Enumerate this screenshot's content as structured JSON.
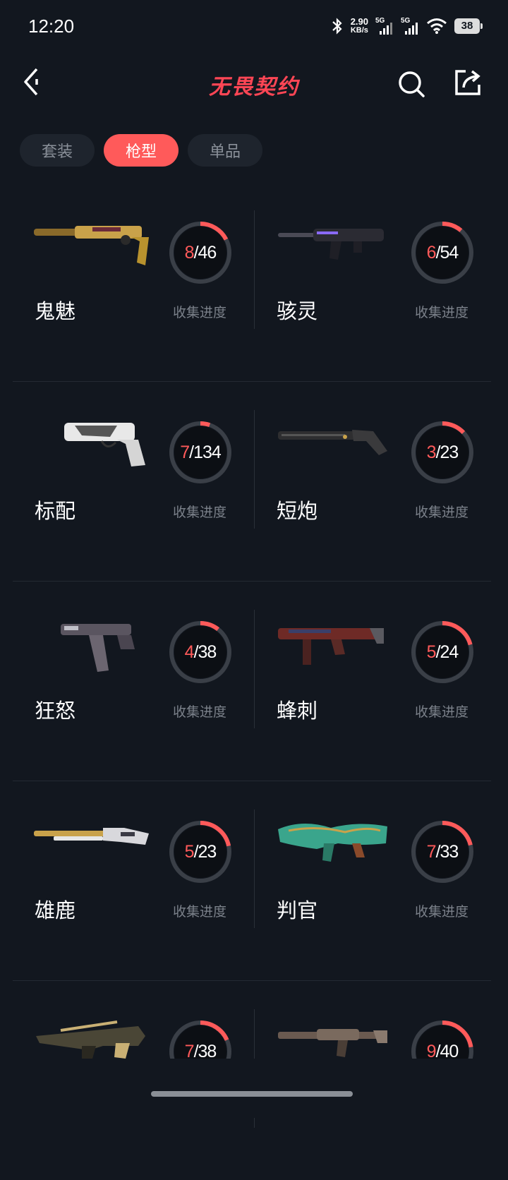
{
  "status_bar": {
    "time": "12:20",
    "net_speed_value": "2.90",
    "net_speed_unit": "KB/s",
    "signal1_label": "5G",
    "signal2_label": "5G",
    "battery": "38"
  },
  "header": {
    "title": "无畏契约"
  },
  "tabs": [
    {
      "label": "套装",
      "active": false
    },
    {
      "label": "枪型",
      "active": true
    },
    {
      "label": "单品",
      "active": false
    }
  ],
  "progress_label": "收集进度",
  "weapons": [
    {
      "name": "鬼魅",
      "collected": "8",
      "total": "46",
      "progress": 0.174
    },
    {
      "name": "骇灵",
      "collected": "6",
      "total": "54",
      "progress": 0.111
    },
    {
      "name": "标配",
      "collected": "7",
      "total": "134",
      "progress": 0.052
    },
    {
      "name": "短炮",
      "collected": "3",
      "total": "23",
      "progress": 0.13
    },
    {
      "name": "狂怒",
      "collected": "4",
      "total": "38",
      "progress": 0.105
    },
    {
      "name": "蜂刺",
      "collected": "5",
      "total": "24",
      "progress": 0.208
    },
    {
      "name": "雄鹿",
      "collected": "5",
      "total": "23",
      "progress": 0.217
    },
    {
      "name": "判官",
      "collected": "7",
      "total": "33",
      "progress": 0.212
    },
    {
      "name": "",
      "collected": "7",
      "total": "38",
      "progress": 0.184
    },
    {
      "name": "",
      "collected": "9",
      "total": "40",
      "progress": 0.225
    }
  ],
  "colors": {
    "accent": "#ff5a5a",
    "background": "#12171f",
    "ring_track": "#3a3f47"
  }
}
